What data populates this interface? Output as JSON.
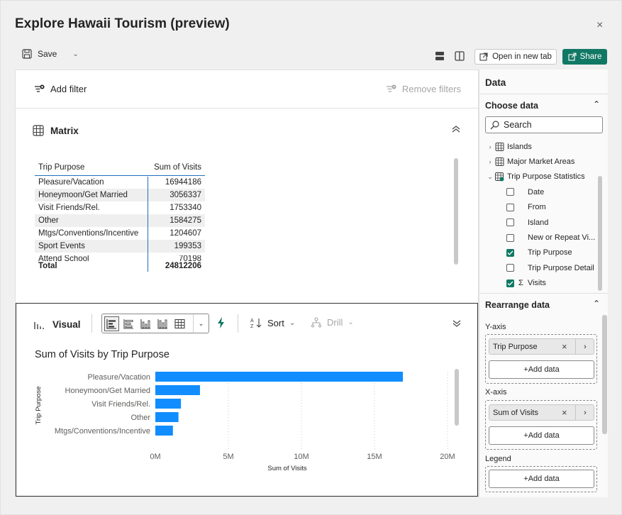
{
  "dialog": {
    "title": "Explore Hawaii Tourism (preview)",
    "close_glyph": "×"
  },
  "toolbar": {
    "save_label": "Save",
    "open_new_tab_label": "Open in new tab",
    "share_label": "Share"
  },
  "filter_bar": {
    "add_filter_label": "Add filter",
    "remove_filters_label": "Remove filters"
  },
  "matrix": {
    "title": "Matrix",
    "columns": [
      "Trip Purpose",
      "Sum of Visits"
    ],
    "rows": [
      {
        "label": "Pleasure/Vacation",
        "value": "16944186"
      },
      {
        "label": "Honeymoon/Get Married",
        "value": "3056337"
      },
      {
        "label": "Visit Friends/Rel.",
        "value": "1753340"
      },
      {
        "label": "Other",
        "value": "1584275"
      },
      {
        "label": "Mtgs/Conventions/Incentive",
        "value": "1204607"
      },
      {
        "label": "Sport Events",
        "value": "199353"
      },
      {
        "label": "Attend School",
        "value": "70198"
      }
    ],
    "total_label": "Total",
    "total_value": "24812206"
  },
  "visual": {
    "title": "Visual",
    "sort_label": "Sort",
    "drill_label": "Drill"
  },
  "chart_data": {
    "type": "bar",
    "orientation": "horizontal",
    "title": "Sum of Visits by Trip Purpose",
    "categories": [
      "Pleasure/Vacation",
      "Honeymoon/Get Married",
      "Visit Friends/Rel.",
      "Other",
      "Mtgs/Conventions/Incentive"
    ],
    "values": [
      16944186,
      3056337,
      1753340,
      1584275,
      1204607
    ],
    "xlabel": "Sum of Visits",
    "ylabel": "Trip Purpose",
    "xlim": [
      0,
      20000000
    ],
    "x_ticks": [
      0,
      5000000,
      10000000,
      15000000,
      20000000
    ],
    "x_tick_labels": [
      "0M",
      "5M",
      "10M",
      "15M",
      "20M"
    ],
    "grid": "vertical dotted",
    "bar_color": "#118dff"
  },
  "data_pane": {
    "title": "Data",
    "choose_data_label": "Choose data",
    "search_placeholder": "Search",
    "tables": [
      {
        "name": "Islands",
        "expanded": false
      },
      {
        "name": "Major Market Areas",
        "expanded": false
      },
      {
        "name": "Trip Purpose Statistics",
        "expanded": true
      }
    ],
    "fields": [
      {
        "name": "Date",
        "checked": false,
        "sigma": false
      },
      {
        "name": "From",
        "checked": false,
        "sigma": false
      },
      {
        "name": "Island",
        "checked": false,
        "sigma": false
      },
      {
        "name": "New or Repeat Vi...",
        "checked": false,
        "sigma": false
      },
      {
        "name": "Trip Purpose",
        "checked": true,
        "sigma": false
      },
      {
        "name": "Trip Purpose Detail",
        "checked": false,
        "sigma": false
      },
      {
        "name": "Visits",
        "checked": true,
        "sigma": true
      }
    ],
    "rearrange_label": "Rearrange data",
    "y_axis_label": "Y-axis",
    "y_axis_field": "Trip Purpose",
    "x_axis_label": "X-axis",
    "x_axis_field": "Sum of Visits",
    "legend_label": "Legend",
    "add_data_label": "+Add data"
  },
  "colors": {
    "accent": "#117865",
    "bar": "#118dff",
    "matrix_line": "#1f6fbf"
  }
}
